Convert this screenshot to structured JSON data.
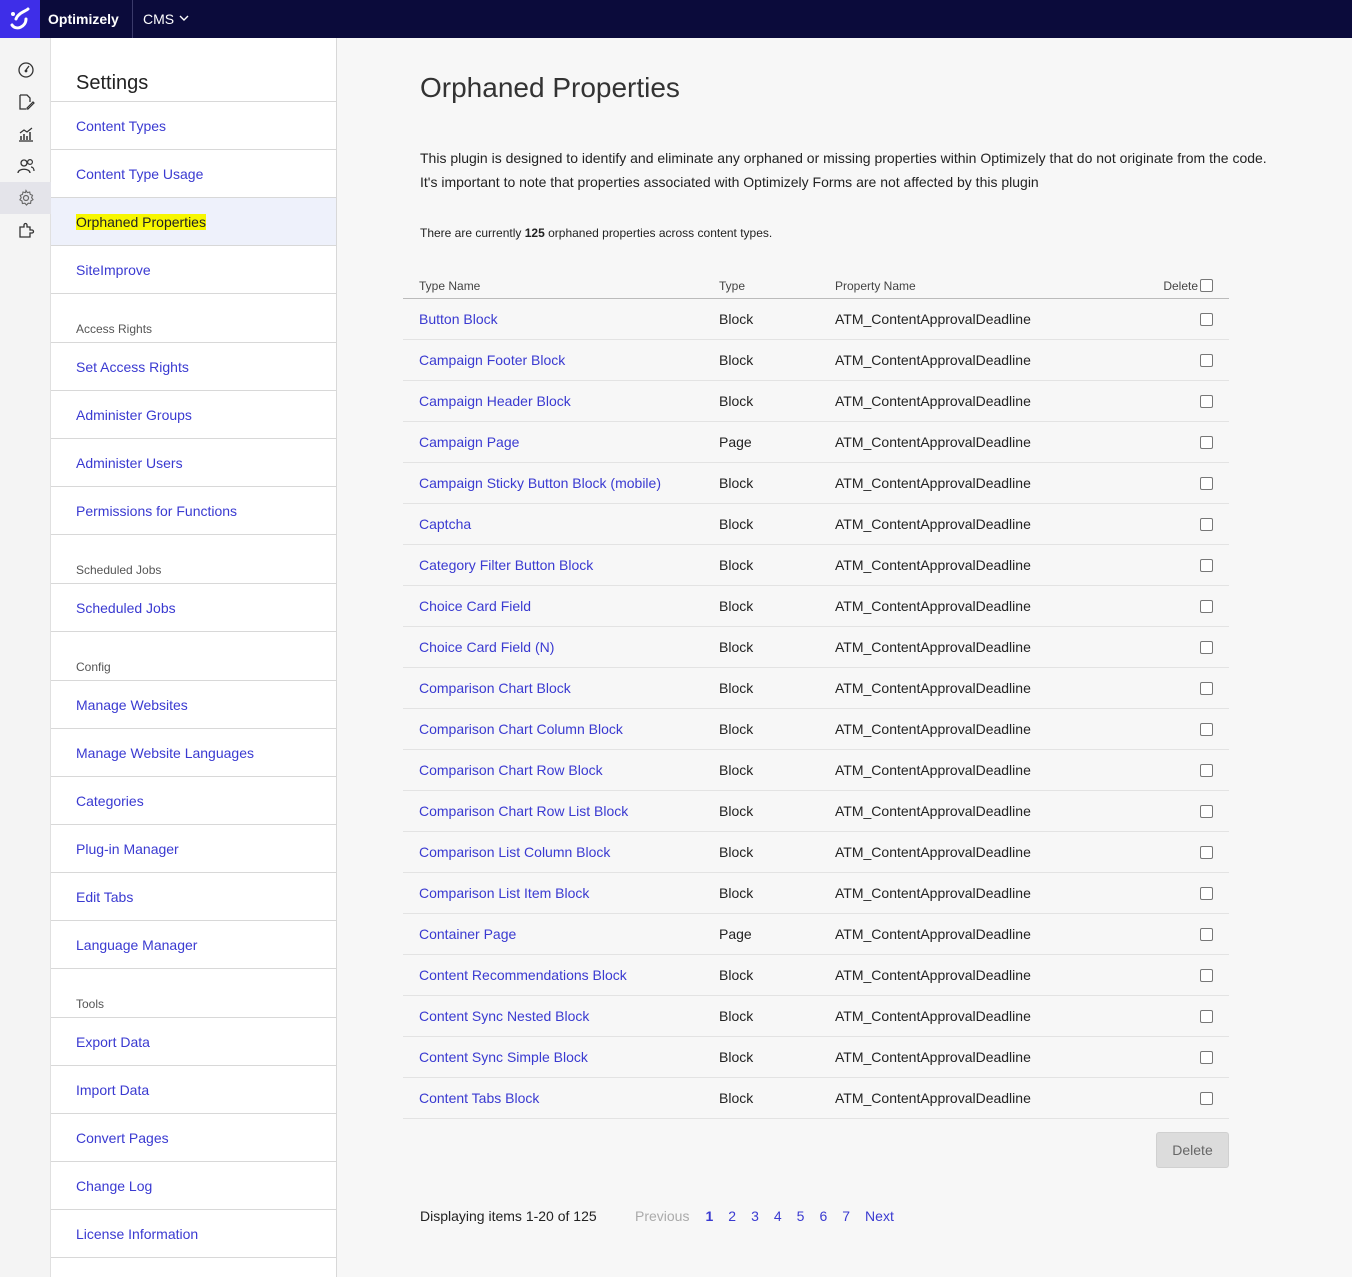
{
  "topbar": {
    "brand": "Optimizely",
    "product": "CMS"
  },
  "rail": [
    "dashboard-icon",
    "edit-icon",
    "analytics-icon",
    "users-icon",
    "settings-icon",
    "addons-icon"
  ],
  "sidebar": {
    "title": "Settings",
    "items": [
      {
        "label": "Content Types"
      },
      {
        "label": "Content Type Usage"
      },
      {
        "label": "Orphaned Properties",
        "active": true
      },
      {
        "label": "SiteImprove"
      }
    ],
    "sections": [
      {
        "title": "Access Rights",
        "items": [
          "Set Access Rights",
          "Administer Groups",
          "Administer Users",
          "Permissions for Functions"
        ]
      },
      {
        "title": "Scheduled Jobs",
        "items": [
          "Scheduled Jobs"
        ]
      },
      {
        "title": "Config",
        "items": [
          "Manage Websites",
          "Manage Website Languages",
          "Categories",
          "Plug-in Manager",
          "Edit Tabs",
          "Language Manager"
        ]
      },
      {
        "title": "Tools",
        "items": [
          "Export Data",
          "Import Data",
          "Convert Pages",
          "Change Log",
          "License Information"
        ]
      }
    ]
  },
  "main": {
    "title": "Orphaned Properties",
    "description_line1": "This plugin is designed to identify and eliminate any orphaned or missing properties within Optimizely that do not originate from the code.",
    "description_line2": "It's important to note that properties associated with Optimizely Forms are not affected by this plugin",
    "count_prefix": "There are currently",
    "count_value": "125",
    "count_suffix": "orphaned properties across content types."
  },
  "table": {
    "headers": {
      "type_name": "Type Name",
      "type": "Type",
      "property_name": "Property Name",
      "delete": "Delete"
    },
    "rows": [
      {
        "type_name": "Button Block",
        "type": "Block",
        "property": "ATM_ContentApprovalDeadline"
      },
      {
        "type_name": "Campaign Footer Block",
        "type": "Block",
        "property": "ATM_ContentApprovalDeadline"
      },
      {
        "type_name": "Campaign Header Block",
        "type": "Block",
        "property": "ATM_ContentApprovalDeadline"
      },
      {
        "type_name": "Campaign Page",
        "type": "Page",
        "property": "ATM_ContentApprovalDeadline"
      },
      {
        "type_name": "Campaign Sticky Button Block (mobile)",
        "type": "Block",
        "property": "ATM_ContentApprovalDeadline"
      },
      {
        "type_name": "Captcha",
        "type": "Block",
        "property": "ATM_ContentApprovalDeadline"
      },
      {
        "type_name": "Category Filter Button Block",
        "type": "Block",
        "property": "ATM_ContentApprovalDeadline"
      },
      {
        "type_name": "Choice Card Field",
        "type": "Block",
        "property": "ATM_ContentApprovalDeadline"
      },
      {
        "type_name": "Choice Card Field (N)",
        "type": "Block",
        "property": "ATM_ContentApprovalDeadline"
      },
      {
        "type_name": "Comparison Chart Block",
        "type": "Block",
        "property": "ATM_ContentApprovalDeadline"
      },
      {
        "type_name": "Comparison Chart Column Block",
        "type": "Block",
        "property": "ATM_ContentApprovalDeadline"
      },
      {
        "type_name": "Comparison Chart Row Block",
        "type": "Block",
        "property": "ATM_ContentApprovalDeadline"
      },
      {
        "type_name": "Comparison Chart Row List Block",
        "type": "Block",
        "property": "ATM_ContentApprovalDeadline"
      },
      {
        "type_name": "Comparison List Column Block",
        "type": "Block",
        "property": "ATM_ContentApprovalDeadline"
      },
      {
        "type_name": "Comparison List Item Block",
        "type": "Block",
        "property": "ATM_ContentApprovalDeadline"
      },
      {
        "type_name": "Container Page",
        "type": "Page",
        "property": "ATM_ContentApprovalDeadline"
      },
      {
        "type_name": "Content Recommendations Block",
        "type": "Block",
        "property": "ATM_ContentApprovalDeadline"
      },
      {
        "type_name": "Content Sync Nested Block",
        "type": "Block",
        "property": "ATM_ContentApprovalDeadline"
      },
      {
        "type_name": "Content Sync Simple Block",
        "type": "Block",
        "property": "ATM_ContentApprovalDeadline"
      },
      {
        "type_name": "Content Tabs Block",
        "type": "Block",
        "property": "ATM_ContentApprovalDeadline"
      }
    ]
  },
  "actions": {
    "delete_label": "Delete"
  },
  "pagination": {
    "display_text": "Displaying items 1-20 of 125",
    "previous": "Previous",
    "pages": [
      "1",
      "2",
      "3",
      "4",
      "5",
      "6",
      "7"
    ],
    "current": "1",
    "next": "Next"
  },
  "colors": {
    "topbar": "#0b0b3b",
    "logo_bg": "#3e2ee8",
    "link": "#3a3ad1",
    "highlight": "#f7f700"
  }
}
